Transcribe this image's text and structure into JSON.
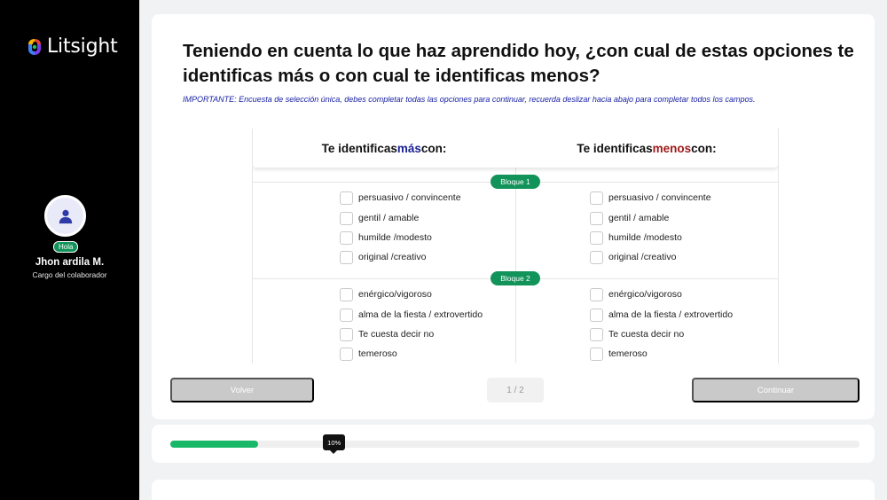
{
  "sidebar": {
    "logo_text": "Litsight",
    "greeting": "Hola",
    "user_name": "Jhon ardila M.",
    "user_role": "Cargo del colaborador"
  },
  "survey": {
    "title": "Teniendo en cuenta lo que haz aprendido hoy, ¿con cual de estas opciones te identificas más o con cual te identificas menos?",
    "important": "IMPORTANTE: Encuesta de selección única, debes completar todas las opciones para continuar, recuerda deslizar hacia abajo para completar todos los campos.",
    "col_left": {
      "prefix": "Te identificas ",
      "highlight": "más",
      "suffix": " con:"
    },
    "col_right": {
      "prefix": "Te identificas ",
      "highlight": "menos",
      "suffix": " con:"
    },
    "blocks": [
      {
        "label": "Bloque 1",
        "options": [
          "persuasivo / convincente",
          "gentil / amable",
          "humilde /modesto",
          "original /creativo"
        ]
      },
      {
        "label": "Bloque 2",
        "options": [
          "enérgico/vigoroso",
          "alma de la fiesta / extrovertido",
          "Te cuesta decir no",
          "temeroso"
        ]
      }
    ]
  },
  "nav": {
    "back_label": "Volver",
    "page_indicator": "1 / 2",
    "next_label": "Continuar"
  },
  "progress": {
    "percent": 10,
    "label": "10%"
  },
  "colors": {
    "accent_green": "#12935a",
    "progress_green": "#18b868",
    "highlight_blue": "#1a2296",
    "highlight_red": "#a01a1a",
    "important_blue": "#1a23a3"
  }
}
